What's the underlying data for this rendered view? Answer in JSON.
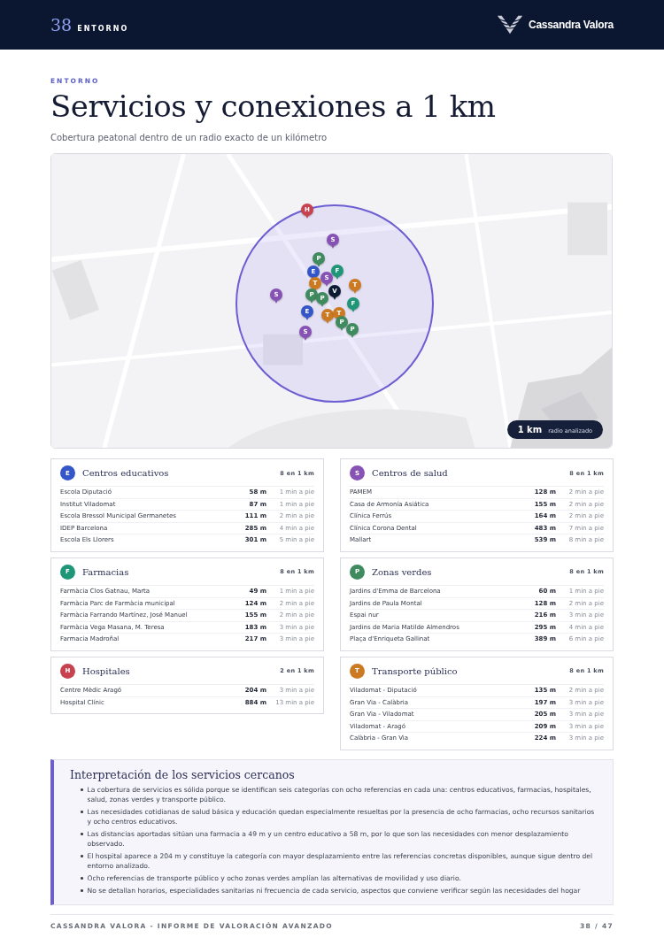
{
  "header": {
    "page_number": "38",
    "section": "ENTORNO",
    "brand": "Cassandra Valora"
  },
  "eyebrow": "ENTORNO",
  "title": "Servicios y conexiones a 1 km",
  "subtitle": "Cobertura peatonal dentro de un radio exacto de un kilómetro",
  "map": {
    "radius_value": "1 km",
    "radius_label": "radio analizado",
    "pins": [
      {
        "letter": "H",
        "color": "#c8414f"
      },
      {
        "letter": "S",
        "color": "#8653b5"
      },
      {
        "letter": "P",
        "color": "#3f8a5e"
      },
      {
        "letter": "E",
        "color": "#3556c8"
      },
      {
        "letter": "F",
        "color": "#1f9678"
      },
      {
        "letter": "S",
        "color": "#8653b5"
      },
      {
        "letter": "T",
        "color": "#cc7a22"
      },
      {
        "letter": "T",
        "color": "#cc7a22"
      },
      {
        "letter": "S",
        "color": "#8653b5"
      },
      {
        "letter": "P",
        "color": "#3f8a5e"
      },
      {
        "letter": "P",
        "color": "#3f8a5e"
      },
      {
        "letter": "F",
        "color": "#1f9678"
      },
      {
        "letter": "E",
        "color": "#3556c8"
      },
      {
        "letter": "T",
        "color": "#cc7a22"
      },
      {
        "letter": "T",
        "color": "#cc7a22"
      },
      {
        "letter": "P",
        "color": "#3f8a5e"
      },
      {
        "letter": "S",
        "color": "#8653b5"
      },
      {
        "letter": "P",
        "color": "#3f8a5e"
      },
      {
        "letter": "V",
        "color": "#0d1a33"
      }
    ]
  },
  "categories": [
    {
      "letter": "E",
      "color": "#3556c8",
      "title": "Centros educativos",
      "count": "8 en 1 km",
      "items": [
        {
          "name": "Escola Diputació",
          "distance": "58 m",
          "time": "1 min a pie"
        },
        {
          "name": "Institut Viladomat",
          "distance": "87 m",
          "time": "1 min a pie"
        },
        {
          "name": "Escola Bressol Municipal Germanetes",
          "distance": "111 m",
          "time": "2 min a pie"
        },
        {
          "name": "IDEP Barcelona",
          "distance": "285 m",
          "time": "4 min a pie"
        },
        {
          "name": "Escola Els Llorers",
          "distance": "301 m",
          "time": "5 min a pie"
        }
      ]
    },
    {
      "letter": "S",
      "color": "#8653b5",
      "title": "Centros de salud",
      "count": "8 en 1 km",
      "items": [
        {
          "name": "PAMEM",
          "distance": "128 m",
          "time": "2 min a pie"
        },
        {
          "name": "Casa de Armonía Asiática",
          "distance": "155 m",
          "time": "2 min a pie"
        },
        {
          "name": "Clínica Ferrús",
          "distance": "164 m",
          "time": "2 min a pie"
        },
        {
          "name": "Clínica Corona Dental",
          "distance": "483 m",
          "time": "7 min a pie"
        },
        {
          "name": "Mallart",
          "distance": "539 m",
          "time": "8 min a pie"
        }
      ]
    },
    {
      "letter": "F",
      "color": "#1f9678",
      "title": "Farmacias",
      "count": "8 en 1 km",
      "items": [
        {
          "name": "Farmàcia Clos Gatnau, Marta",
          "distance": "49 m",
          "time": "1 min a pie"
        },
        {
          "name": "Farmàcia Parc de Farmàcia municipal",
          "distance": "124 m",
          "time": "2 min a pie"
        },
        {
          "name": "Farmàcia Farrando Martínez, José Manuel",
          "distance": "155 m",
          "time": "2 min a pie"
        },
        {
          "name": "Farmàcia Vega Masana, M. Teresa",
          "distance": "183 m",
          "time": "3 min a pie"
        },
        {
          "name": "Farmacia Madroñal",
          "distance": "217 m",
          "time": "3 min a pie"
        }
      ]
    },
    {
      "letter": "P",
      "color": "#3f8a5e",
      "title": "Zonas verdes",
      "count": "8 en 1 km",
      "items": [
        {
          "name": "Jardins d'Emma de Barcelona",
          "distance": "60 m",
          "time": "1 min a pie"
        },
        {
          "name": "Jardins de Paula Montal",
          "distance": "128 m",
          "time": "2 min a pie"
        },
        {
          "name": "Espai nur",
          "distance": "216 m",
          "time": "3 min a pie"
        },
        {
          "name": "Jardins de Maria Matilde Almendros",
          "distance": "295 m",
          "time": "4 min a pie"
        },
        {
          "name": "Plaça d'Enriqueta Gallinat",
          "distance": "389 m",
          "time": "6 min a pie"
        }
      ]
    },
    {
      "letter": "H",
      "color": "#c8414f",
      "title": "Hospitales",
      "count": "2 en 1 km",
      "items": [
        {
          "name": "Centre Mèdic Aragó",
          "distance": "204 m",
          "time": "3 min a pie"
        },
        {
          "name": "Hospital Clínic",
          "distance": "884 m",
          "time": "13 min a pie"
        }
      ]
    },
    {
      "letter": "T",
      "color": "#cc7a22",
      "title": "Transporte público",
      "count": "8 en 1 km",
      "items": [
        {
          "name": "Viladomat - Diputació",
          "distance": "135 m",
          "time": "2 min a pie"
        },
        {
          "name": "Gran Via - Calàbria",
          "distance": "197 m",
          "time": "3 min a pie"
        },
        {
          "name": "Gran Via - Viladomat",
          "distance": "205 m",
          "time": "3 min a pie"
        },
        {
          "name": "Viladomat - Aragó",
          "distance": "209 m",
          "time": "3 min a pie"
        },
        {
          "name": "Calàbria - Gran Via",
          "distance": "224 m",
          "time": "3 min a pie"
        }
      ]
    }
  ],
  "interpretation": {
    "title": "Interpretación de los servicios cercanos",
    "bullets": [
      "La cobertura de servicios es sólida porque se identifican seis categorías con ocho referencias en cada una: centros educativos, farmacias, hospitales, salud, zonas verdes y transporte público.",
      "Las necesidades cotidianas de salud básica y educación quedan especialmente resueltas por la presencia de ocho farmacias, ocho recursos sanitarios y ocho centros educativos.",
      "Las distancias aportadas sitúan una farmacia a 49 m y un centro educativo a 58 m, por lo que son las necesidades con menor desplazamiento observado.",
      "El hospital aparece a 204 m y constituye la categoría con mayor desplazamiento entre las referencias concretas disponibles, aunque sigue dentro del entorno analizado.",
      "Ocho referencias de transporte público y ocho zonas verdes amplían las alternativas de movilidad y uso diario.",
      "No se detallan horarios, especialidades sanitarias ni frecuencia de cada servicio, aspectos que conviene verificar según las necesidades del hogar"
    ]
  },
  "footer": {
    "report": "CASSANDRA VALORA - INFORME DE VALORACIÓN AVANZADO",
    "pages": "38 / 47"
  }
}
